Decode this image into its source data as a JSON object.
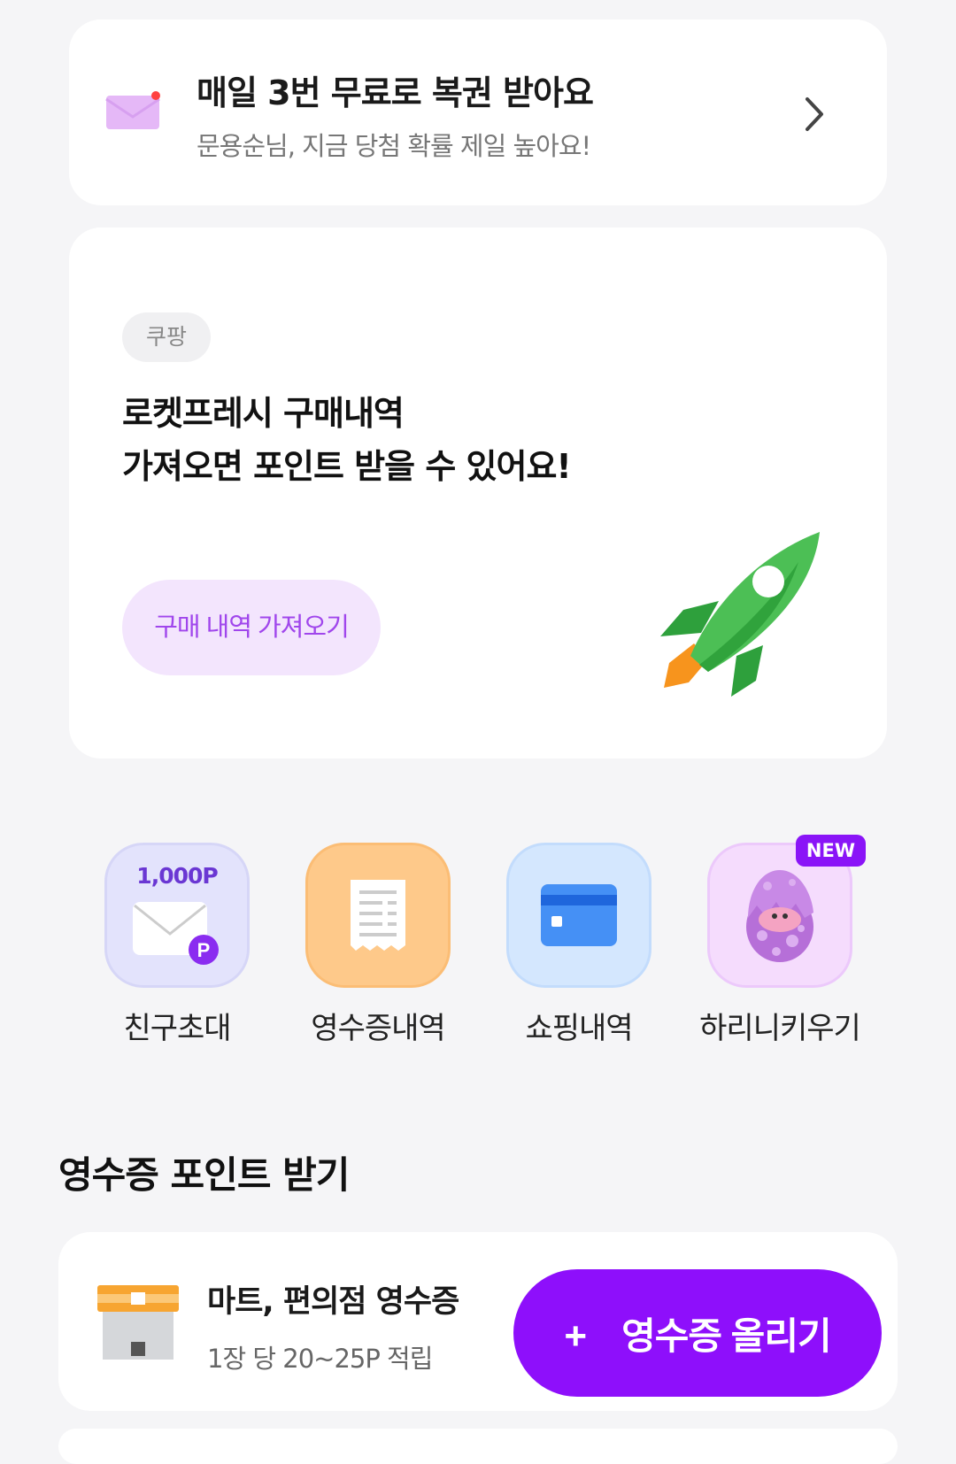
{
  "lottery": {
    "title": "매일 3번 무료로 복권 받아요",
    "subtitle": "문용순님, 지금 당첨 확률 제일 높아요!"
  },
  "coupang": {
    "tag": "쿠팡",
    "headline_line1": "로켓프레시 구매내역",
    "headline_line2": "가져오면 포인트 받을 수 있어요!",
    "button": "구매 내역 가져오기"
  },
  "quick_menu": [
    {
      "label": "친구초대",
      "points": "1,000P",
      "icon": "invite-envelope-icon"
    },
    {
      "label": "영수증내역",
      "icon": "receipt-icon"
    },
    {
      "label": "쇼핑내역",
      "icon": "card-icon"
    },
    {
      "label": "하리니키우기",
      "badge": "NEW",
      "icon": "egg-character-icon"
    }
  ],
  "receipt_section": {
    "title": "영수증 포인트 받기",
    "item_title": "마트, 편의점 영수증",
    "item_sub": "1장 당 20~25P 적립",
    "upload_plus": "+",
    "upload_label": "영수증 올리기"
  },
  "colors": {
    "accent": "#8e0ffb",
    "button_light_bg": "#f3e5fd",
    "button_light_text": "#a046ec",
    "rocket_green": "#39b54a",
    "rocket_flame": "#f7941d"
  }
}
